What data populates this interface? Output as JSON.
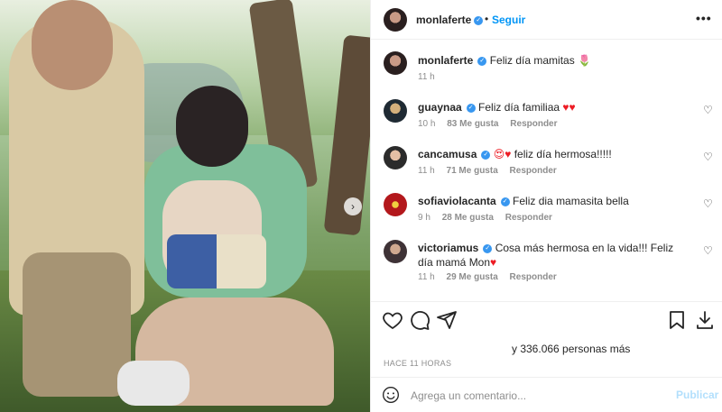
{
  "post": {
    "author": "monlaferte",
    "separator": "•",
    "follow_label": "Seguir",
    "more_label": "•••",
    "caption": {
      "username": "monlaferte",
      "text": "Feliz día mamitas",
      "emoji": "🌷",
      "time": "11 h"
    }
  },
  "comments": [
    {
      "username": "guaynaa",
      "text": "Feliz día familiaa",
      "emoji": "♥♥",
      "time": "10 h",
      "likes": "83 Me gusta",
      "reply": "Responder"
    },
    {
      "username": "cancamusa",
      "emoji": "😍♥",
      "text": "feliz día hermosa!!!!!",
      "time": "11 h",
      "likes": "71 Me gusta",
      "reply": "Responder"
    },
    {
      "username": "sofiaviolacanta",
      "text": "Feliz dia mamasita bella",
      "time": "9 h",
      "likes": "28 Me gusta",
      "reply": "Responder"
    },
    {
      "username": "victoriamus",
      "text": "Cosa más hermosa en la vida!!! Feliz día mamá Mon",
      "emoji": "♥",
      "time": "11 h",
      "likes": "29 Me gusta",
      "reply": "Responder"
    }
  ],
  "actions": {
    "like_icon": "heart-icon",
    "comment_icon": "comment-icon",
    "share_icon": "send-icon",
    "save_icon": "bookmark-icon",
    "download_icon": "download-icon"
  },
  "likes_text": "y 336.066 personas más",
  "time_ago": "HACE 11 HORAS",
  "composer": {
    "placeholder": "Agrega un comentario...",
    "publish_label": "Publicar"
  },
  "colors": {
    "link_blue": "#0095f6",
    "verified_blue": "#3897f0",
    "heart_red": "#ed1c24",
    "publish_disabled": "#b2dffc"
  }
}
